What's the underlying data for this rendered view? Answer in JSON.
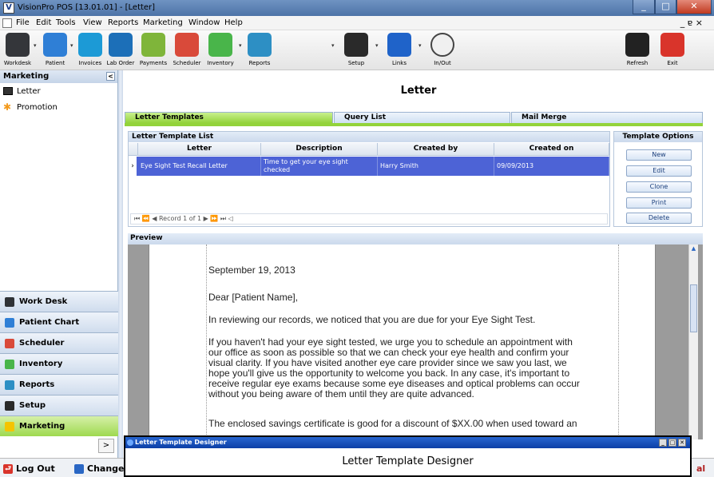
{
  "window": {
    "title": "VisionPro POS  [13.01.01] - [Letter]",
    "app_icon": "V"
  },
  "menu": {
    "items": [
      "File",
      "Edit",
      "Tools",
      "View",
      "Reports",
      "Marketing",
      "Window",
      "Help"
    ],
    "mdi_controls": "_ ɐ ×"
  },
  "toolbar": {
    "items": [
      {
        "label": "Workdesk",
        "icon": "workdesk-icon",
        "color": "#34363a"
      },
      {
        "label": "Patient",
        "icon": "patient-icon",
        "color": "#2f7fd6"
      },
      {
        "label": "Invoices",
        "icon": "invoices-icon",
        "color": "#1c9ad6"
      },
      {
        "label": "Lab Order",
        "icon": "lab-order-icon",
        "color": "#1c6fb8"
      },
      {
        "label": "Payments",
        "icon": "payments-icon",
        "color": "#7fb53a"
      },
      {
        "label": "Scheduler",
        "icon": "scheduler-icon",
        "color": "#d94a3a"
      },
      {
        "label": "Inventory",
        "icon": "inventory-icon",
        "color": "#49b54a"
      },
      {
        "label": "Reports",
        "icon": "reports-icon",
        "color": "#2d8fc4"
      },
      {
        "label": "Setup",
        "icon": "setup-icon",
        "color": "#2a2a2a"
      },
      {
        "label": "Links",
        "icon": "links-icon",
        "color": "#1f63c9"
      },
      {
        "label": "In/Out",
        "icon": "clock-icon",
        "color": "#f0f0f0"
      },
      {
        "label": "Refresh",
        "icon": "refresh-icon",
        "color": "#222222"
      },
      {
        "label": "Exit",
        "icon": "exit-icon",
        "color": "#d9342b"
      }
    ]
  },
  "left_panel": {
    "header": "Marketing",
    "collapse": "<",
    "items": [
      {
        "label": "Letter",
        "icon": "envelope-icon"
      },
      {
        "label": "Promotion",
        "icon": "star-icon"
      }
    ]
  },
  "nav": {
    "items": [
      {
        "label": "Work Desk",
        "color": "#2f3236"
      },
      {
        "label": "Patient Chart",
        "color": "#2f7fd6"
      },
      {
        "label": "Scheduler",
        "color": "#d94a3a"
      },
      {
        "label": "Inventory",
        "color": "#49b54a"
      },
      {
        "label": "Reports",
        "color": "#2d8fc4"
      },
      {
        "label": "Setup",
        "color": "#2a2a2a"
      },
      {
        "label": "Marketing",
        "color": "#f5c400"
      }
    ],
    "expand": ">"
  },
  "status": {
    "logout": "Log Out",
    "change": "Change",
    "right_fragment": "al"
  },
  "main": {
    "title": "Letter",
    "tabs": [
      "Letter Templates",
      "Query List",
      "Mail Merge"
    ],
    "list": {
      "header": "Letter Template List",
      "columns": [
        "Letter",
        "Description",
        "Created by",
        "Created on"
      ],
      "rows": [
        {
          "letter": "Eye Sight Test Recall Letter",
          "description": "Time to get your eye sight checked",
          "created_by": "Harry Smith",
          "created_on": "09/09/2013"
        }
      ],
      "pager": "Record 1 of 1"
    },
    "options": {
      "header": "Template Options",
      "buttons": [
        "New",
        "Edit",
        "Clone",
        "Print",
        "Delete"
      ]
    },
    "preview": {
      "header": "Preview",
      "date": "September 19, 2013",
      "salutation": "Dear [Patient Name],",
      "p1": "In reviewing our records, we noticed that you are due for your Eye Sight Test.",
      "p2_lines": [
        "If you haven't had your eye sight tested, we urge you to schedule an appointment with",
        "our office as soon as possible so that we can check your eye health and confirm your",
        "visual clarity. If you have visited another eye care provider since we saw you last, we",
        "hope you'll give us the opportunity to welcome you back. In any case, it's important to",
        "receive regular eye exams because some eye diseases and optical problems can occur",
        "without you being aware of them until they are quite advanced."
      ],
      "p3": "The enclosed savings certificate is good for a discount of $XX.00 when used toward an"
    }
  },
  "designer": {
    "title": "Letter Template Designer",
    "body": "Letter Template Designer"
  }
}
